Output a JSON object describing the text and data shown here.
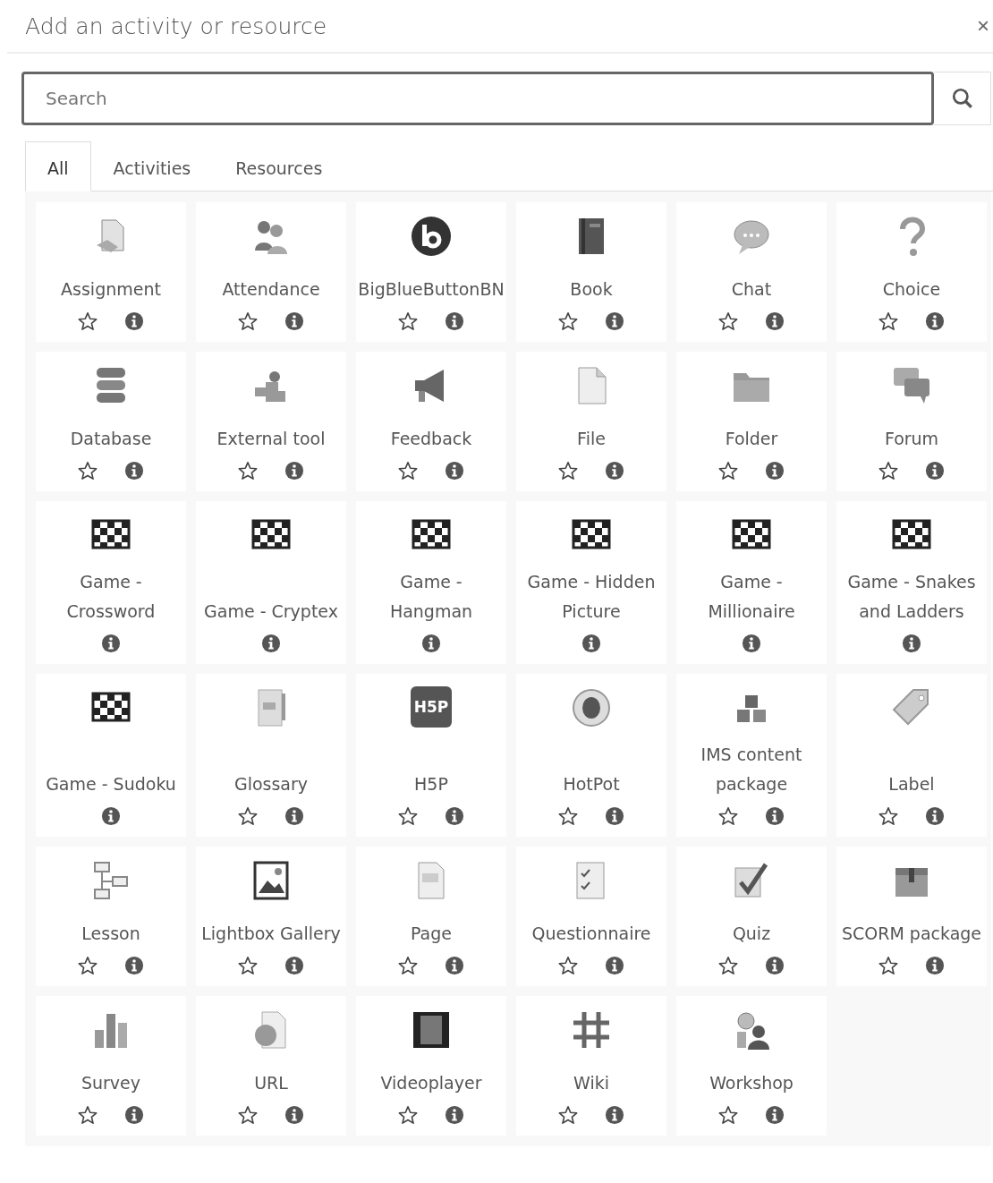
{
  "dialog": {
    "title": "Add an activity or resource",
    "close": "×"
  },
  "search": {
    "placeholder": "Search"
  },
  "tabs": [
    {
      "label": "All",
      "selected": true
    },
    {
      "label": "Activities",
      "selected": false
    },
    {
      "label": "Resources",
      "selected": false
    }
  ],
  "items": [
    {
      "name": "Assignment",
      "kind": "assignment",
      "star": true
    },
    {
      "name": "Attendance",
      "kind": "people",
      "star": true
    },
    {
      "name": "BigBlueButtonBN",
      "kind": "bbb",
      "star": true
    },
    {
      "name": "Book",
      "kind": "book",
      "star": true
    },
    {
      "name": "Chat",
      "kind": "chat",
      "star": true
    },
    {
      "name": "Choice",
      "kind": "question",
      "star": true
    },
    {
      "name": "Database",
      "kind": "database",
      "star": true
    },
    {
      "name": "External tool",
      "kind": "puzzle",
      "star": true
    },
    {
      "name": "Feedback",
      "kind": "megaphone",
      "star": true
    },
    {
      "name": "File",
      "kind": "file",
      "star": true
    },
    {
      "name": "Folder",
      "kind": "folder",
      "star": true
    },
    {
      "name": "Forum",
      "kind": "forum",
      "star": true
    },
    {
      "name": "Game - Crossword",
      "kind": "board",
      "star": false
    },
    {
      "name": "Game - Cryptex",
      "kind": "board",
      "star": false
    },
    {
      "name": "Game - Hangman",
      "kind": "board",
      "star": false
    },
    {
      "name": "Game - Hidden Picture",
      "kind": "board",
      "star": false
    },
    {
      "name": "Game - Millionaire",
      "kind": "board",
      "star": false
    },
    {
      "name": "Game - Snakes and Ladders",
      "kind": "board",
      "star": false
    },
    {
      "name": "Game - Sudoku",
      "kind": "board",
      "star": false
    },
    {
      "name": "Glossary",
      "kind": "glossary",
      "star": true
    },
    {
      "name": "H5P",
      "kind": "h5p",
      "logo": "H5P",
      "star": true
    },
    {
      "name": "HotPot",
      "kind": "hotpot",
      "star": true
    },
    {
      "name": "IMS content package",
      "kind": "boxes",
      "star": true
    },
    {
      "name": "Label",
      "kind": "tag",
      "star": true
    },
    {
      "name": "Lesson",
      "kind": "lesson",
      "star": true
    },
    {
      "name": "Lightbox Gallery",
      "kind": "picture",
      "star": true
    },
    {
      "name": "Page",
      "kind": "page",
      "star": true
    },
    {
      "name": "Questionnaire",
      "kind": "checklist",
      "star": true
    },
    {
      "name": "Quiz",
      "kind": "quiz",
      "star": true
    },
    {
      "name": "SCORM package",
      "kind": "package",
      "star": true
    },
    {
      "name": "Survey",
      "kind": "chart",
      "star": true
    },
    {
      "name": "URL",
      "kind": "globe",
      "star": true
    },
    {
      "name": "Videoplayer",
      "kind": "film",
      "star": true
    },
    {
      "name": "Wiki",
      "kind": "wiki",
      "star": true
    },
    {
      "name": "Workshop",
      "kind": "workshop",
      "star": true
    }
  ]
}
